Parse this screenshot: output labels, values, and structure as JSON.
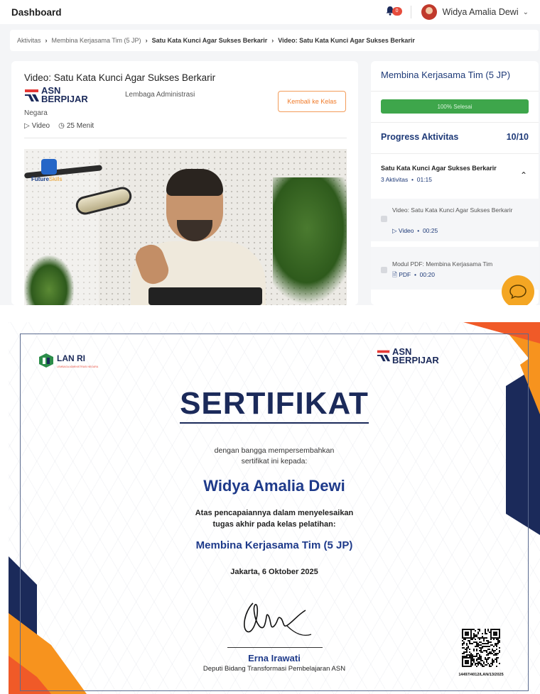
{
  "topbar": {
    "title": "Dashboard",
    "notification_count": "0",
    "username": "Widya Amalia Dewi"
  },
  "breadcrumb": {
    "items": [
      "Aktivitas",
      "Membina Kerjasama Tim (5 JP)",
      "Satu Kata Kunci Agar Sukses Berkarir",
      "Video: Satu Kata Kunci Agar Sukses Berkarir"
    ]
  },
  "content": {
    "title": "Video: Satu Kata Kunci Agar Sukses Berkarir",
    "provider_logo_line1": "ASN",
    "provider_logo_line2": "BERPIJAR",
    "institution_line1": "Lembaga Administrasi",
    "institution_line2": "Negara",
    "type_label": "Video",
    "duration_label": "25 Menit",
    "back_button": "Kembali ke Kelas",
    "video_brand_a": "Future",
    "video_brand_b": "Skills"
  },
  "sidebar": {
    "course_title": "Membina Kerjasama Tim (5 JP)",
    "progress_label": "100% Selesai",
    "progress_value": 1.0,
    "progress_heading": "Progress Aktivitas",
    "progress_count": "10/10",
    "section": {
      "title": "Satu Kata Kunci Agar Sukses Berkarir",
      "activities": "3 Aktivitas",
      "duration": "01:15"
    },
    "items": [
      {
        "title": "Video: Satu Kata Kunci Agar Sukses Berkarir",
        "type": "Video",
        "duration": "00:25"
      },
      {
        "title": "Modul PDF: Membina Kerjasama Tim",
        "type": "PDF",
        "duration": "00:20"
      }
    ]
  },
  "certificate": {
    "left_logo": "LAN RI",
    "left_logo_sub": "LEMBAGA ADMINISTRASI NEGARA",
    "right_logo_line1": "ASN",
    "right_logo_line2": "BERPIJAR",
    "title": "SERTIFIKAT",
    "intro_line1": "dengan bangga mempersembahkan",
    "intro_line2": "sertifikat ini kepada:",
    "recipient": "Widya Amalia Dewi",
    "achievement_line1": "Atas pencapaiannya dalam menyelesaikan",
    "achievement_line2": "tugas akhir pada kelas pelatihan:",
    "course": "Membina Kerjasama Tim (5 JP)",
    "place_date": "Jakarta, 6 Oktober 2025",
    "signer_name": "Erna Irawati",
    "signer_title": "Deputi Bidang Transformasi Pembelajaran ASN",
    "certificate_number": "14497/4012/LAN/13/2025"
  },
  "colors": {
    "navy": "#1b2a5a",
    "accent_orange": "#f07b2a",
    "progress_green": "#3ea64b",
    "chat_yellow": "#f4a623"
  }
}
